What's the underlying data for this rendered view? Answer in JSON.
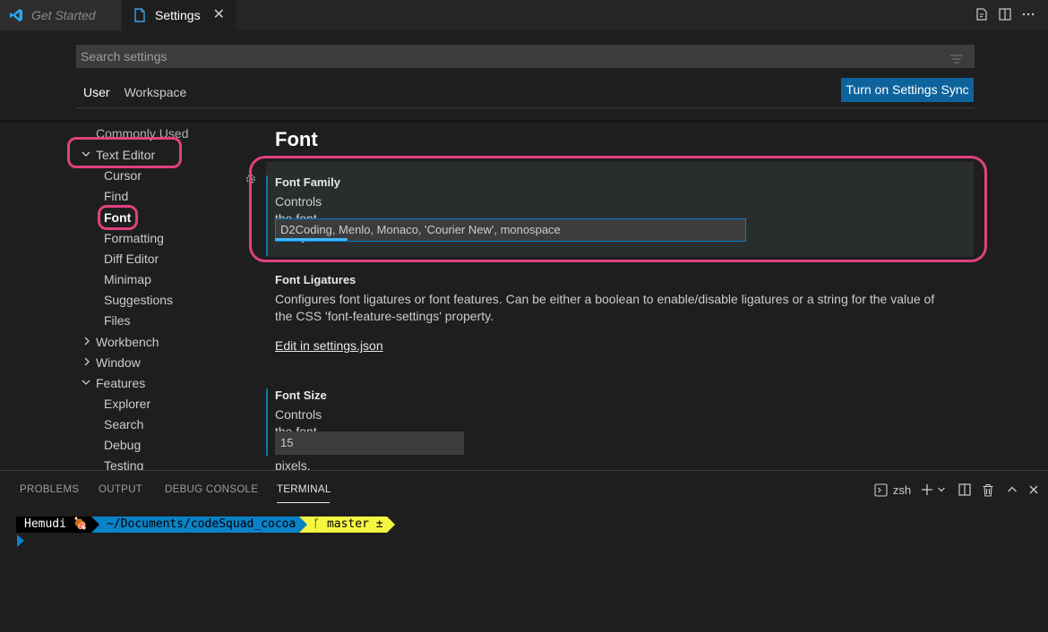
{
  "tabs": [
    {
      "label": "Get Started",
      "active": false
    },
    {
      "label": "Settings",
      "active": true
    }
  ],
  "search": {
    "placeholder": "Search settings"
  },
  "scopes": [
    "User",
    "Workspace"
  ],
  "sync_button": "Turn on Settings Sync",
  "toc": {
    "commonly_used": "Commonly Used",
    "text_editor": "Text Editor",
    "text_editor_children": [
      "Cursor",
      "Find",
      "Font",
      "Formatting",
      "Diff Editor",
      "Minimap",
      "Suggestions",
      "Files"
    ],
    "workbench": "Workbench",
    "window": "Window",
    "features": "Features",
    "features_children": [
      "Explorer",
      "Search",
      "Debug",
      "Testing"
    ]
  },
  "main": {
    "section_title": "Font",
    "font_family": {
      "title": "Font Family",
      "description": "Controls the font family.",
      "value": "D2Coding, Menlo, Monaco, 'Courier New', monospace"
    },
    "font_ligatures": {
      "title": "Font Ligatures",
      "description_line1": "Configures font ligatures or font features. Can be either a boolean to enable/disable ligatures or a string for the value of",
      "description_line2": "the CSS 'font-feature-settings' property.",
      "link": "Edit in settings.json"
    },
    "font_size": {
      "title": "Font Size",
      "description": "Controls the font size in pixels.",
      "value": "15"
    }
  },
  "panel": {
    "tabs": [
      "PROBLEMS",
      "OUTPUT",
      "DEBUG CONSOLE",
      "TERMINAL"
    ],
    "active_tab": "TERMINAL",
    "shell": "zsh"
  },
  "terminal": {
    "user": "Hemudi 🍖",
    "path": "~/Documents/codeSquad_cocoa",
    "git": "ᚴ master ±"
  },
  "colors": {
    "accent": "#0e639c",
    "highlight": "#e0417f",
    "focus_border": "#007fd4"
  }
}
